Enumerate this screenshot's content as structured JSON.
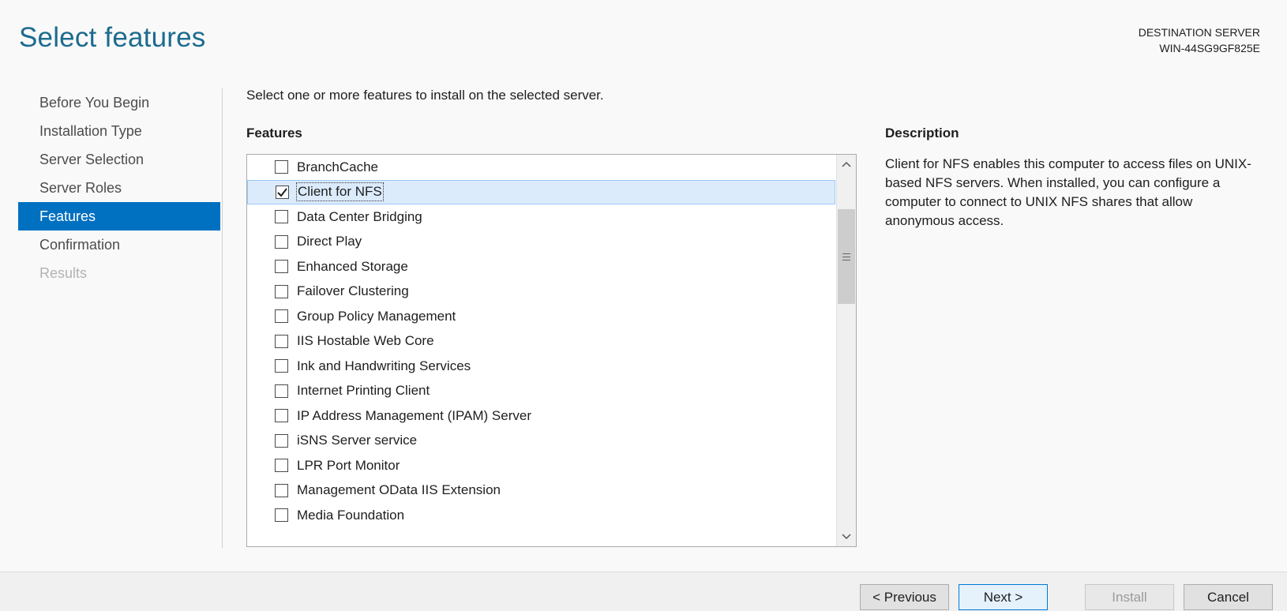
{
  "header": {
    "title": "Select features",
    "destination_label": "DESTINATION SERVER",
    "destination_server": "WIN-44SG9GF825E"
  },
  "nav": {
    "items": [
      {
        "label": "Before You Begin"
      },
      {
        "label": "Installation Type"
      },
      {
        "label": "Server Selection"
      },
      {
        "label": "Server Roles"
      },
      {
        "label": "Features"
      },
      {
        "label": "Confirmation"
      },
      {
        "label": "Results"
      }
    ]
  },
  "main": {
    "instruction": "Select one or more features to install on the selected server.",
    "features_heading": "Features",
    "features": [
      {
        "label": "BranchCache",
        "checked": false
      },
      {
        "label": "Client for NFS",
        "checked": true
      },
      {
        "label": "Data Center Bridging",
        "checked": false
      },
      {
        "label": "Direct Play",
        "checked": false
      },
      {
        "label": "Enhanced Storage",
        "checked": false
      },
      {
        "label": "Failover Clustering",
        "checked": false
      },
      {
        "label": "Group Policy Management",
        "checked": false
      },
      {
        "label": "IIS Hostable Web Core",
        "checked": false
      },
      {
        "label": "Ink and Handwriting Services",
        "checked": false
      },
      {
        "label": "Internet Printing Client",
        "checked": false
      },
      {
        "label": "IP Address Management (IPAM) Server",
        "checked": false
      },
      {
        "label": "iSNS Server service",
        "checked": false
      },
      {
        "label": "LPR Port Monitor",
        "checked": false
      },
      {
        "label": "Management OData IIS Extension",
        "checked": false
      },
      {
        "label": "Media Foundation",
        "checked": false
      }
    ]
  },
  "description": {
    "heading": "Description",
    "text": "Client for NFS enables this computer to access files on UNIX-based NFS servers. When installed, you can configure a computer to connect to UNIX NFS shares that allow anonymous access."
  },
  "footer": {
    "previous_label": "< Previous",
    "next_label": "Next >",
    "install_label": "Install",
    "cancel_label": "Cancel"
  },
  "icons": {
    "scroll_up": "chevron-up-icon",
    "scroll_down": "chevron-down-icon",
    "check": "checkmark-icon"
  },
  "colors": {
    "title": "#1c6b8f",
    "nav_active_bg": "#0070c0",
    "selected_row_bg": "#dcebfc"
  }
}
